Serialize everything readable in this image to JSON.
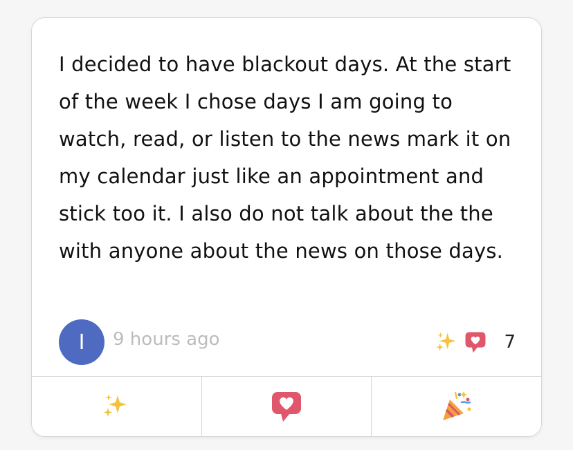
{
  "post": {
    "body": "I decided to have blackout days. At the start of the week I chose days I am going to watch, read, or listen to the news mark it on my calendar just like an appointment and stick too it. I also do not talk about the the with anyone about the news on those days.",
    "author_initial": "I",
    "timestamp": "9 hours ago",
    "reaction_count": "7"
  },
  "reaction_icons": [
    "sparkles-icon",
    "heart-speech-bubble-icon"
  ],
  "actions": [
    {
      "icon": "sparkles-icon"
    },
    {
      "icon": "heart-speech-bubble-icon"
    },
    {
      "icon": "party-popper-icon"
    }
  ],
  "colors": {
    "avatar": "#4f6bc1",
    "sparkle": "#f5c33b",
    "heart_bubble": "#e0566a",
    "timestamp": "#bcbcbc"
  }
}
